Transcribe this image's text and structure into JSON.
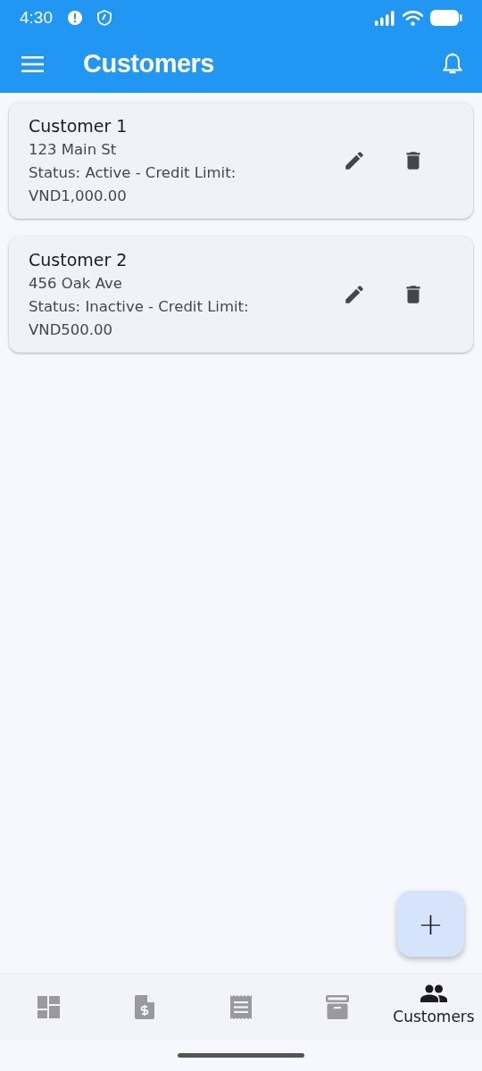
{
  "status_bar": {
    "time": "4:30"
  },
  "app_bar": {
    "title": "Customers"
  },
  "customers": [
    {
      "name": "Customer 1",
      "address": "123 Main St",
      "details": "Status: Active - Credit Limit: VND1,000.00"
    },
    {
      "name": "Customer 2",
      "address": "456 Oak Ave",
      "details": "Status: Inactive - Credit Limit: VND500.00"
    }
  ],
  "fab": {
    "label": "+"
  },
  "bottom_nav": [
    {
      "kind": "dashboard",
      "selected": false
    },
    {
      "kind": "invoice",
      "selected": false
    },
    {
      "kind": "receipt",
      "selected": false
    },
    {
      "kind": "archive",
      "selected": false
    },
    {
      "kind": "customers",
      "selected": true,
      "label": "Customers"
    }
  ]
}
